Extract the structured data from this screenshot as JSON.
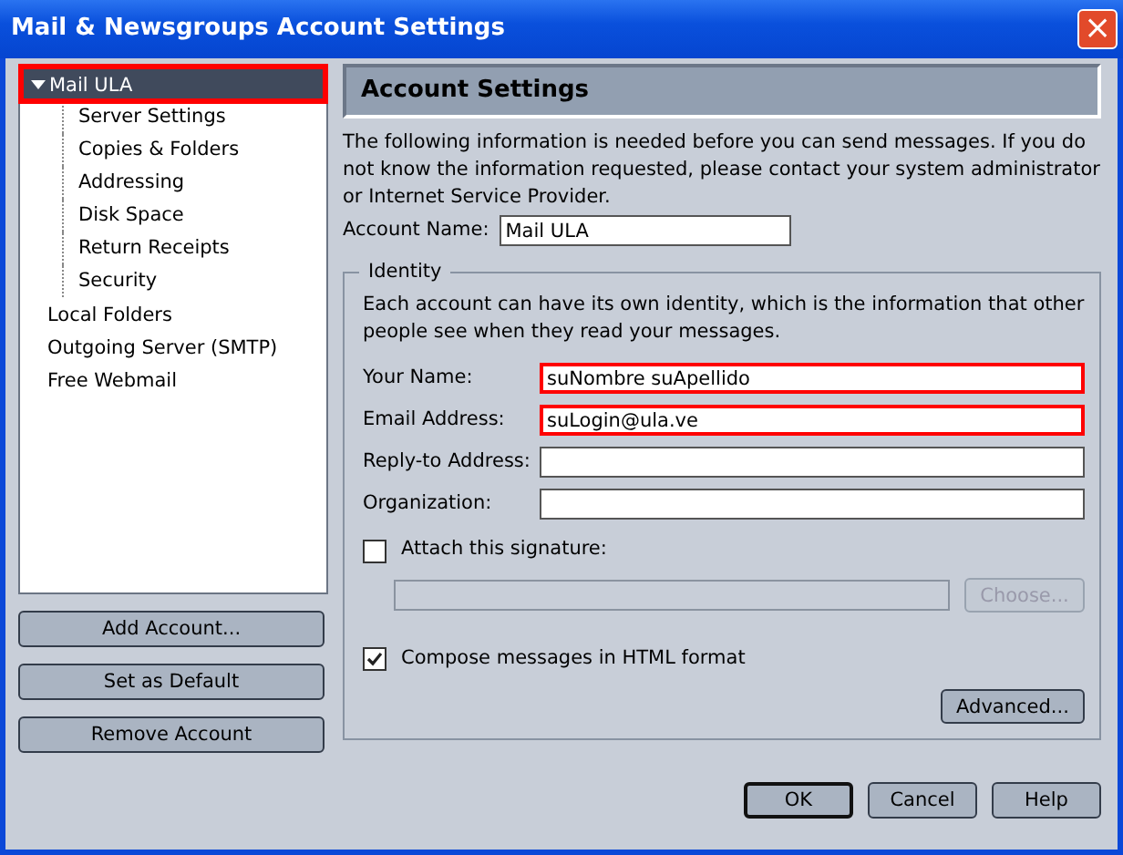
{
  "window": {
    "title": "Mail & Newsgroups Account Settings",
    "close": "×"
  },
  "tree": [
    {
      "label": "Mail ULA",
      "selected": true,
      "expanded": true,
      "highlighted": true,
      "children": [
        {
          "label": "Server Settings",
          "selected": false
        },
        {
          "label": "Copies & Folders",
          "selected": false
        },
        {
          "label": "Addressing",
          "selected": false
        },
        {
          "label": "Disk Space",
          "selected": false
        },
        {
          "label": "Return Receipts",
          "selected": false
        },
        {
          "label": "Security",
          "selected": false
        }
      ]
    },
    {
      "label": "Local Folders",
      "selected": false,
      "highlighted": false
    },
    {
      "label": "Outgoing Server (SMTP)",
      "selected": false,
      "highlighted": false
    },
    {
      "label": "Free Webmail",
      "selected": false,
      "highlighted": false
    }
  ],
  "account_buttons": [
    "Add Account...",
    "Set as Default",
    "Remove Account"
  ],
  "panel": {
    "title": "Account Settings",
    "intro": "The following information is needed before you can send messages. If you do not know the information requested, please contact your system administrator or Internet Service Provider.",
    "account_name": {
      "label": "Account Name:",
      "value": "Mail ULA"
    },
    "identity": {
      "legend": "Identity",
      "text": "Each account can have its own identity, which is the information that other people see when they read your messages.",
      "fields": [
        {
          "label": "Your Name:",
          "value": "suNombre suApellido",
          "highlighted": true
        },
        {
          "label": "Email Address:",
          "value": "suLogin@ula.ve",
          "highlighted": true
        },
        {
          "label": "Reply-to Address:",
          "highlighted": false
        },
        {
          "label": "Organization:",
          "highlighted": false
        }
      ],
      "signature": {
        "label": "Attach this signature:",
        "checked": false,
        "button": "Choose..."
      },
      "html": {
        "label": "Compose messages in HTML format",
        "checked": true
      },
      "advanced": "Advanced..."
    }
  },
  "dialog_buttons": [
    {
      "label": "OK",
      "default": true
    },
    {
      "label": "Cancel",
      "default": false
    },
    {
      "label": "Help",
      "default": false
    }
  ]
}
